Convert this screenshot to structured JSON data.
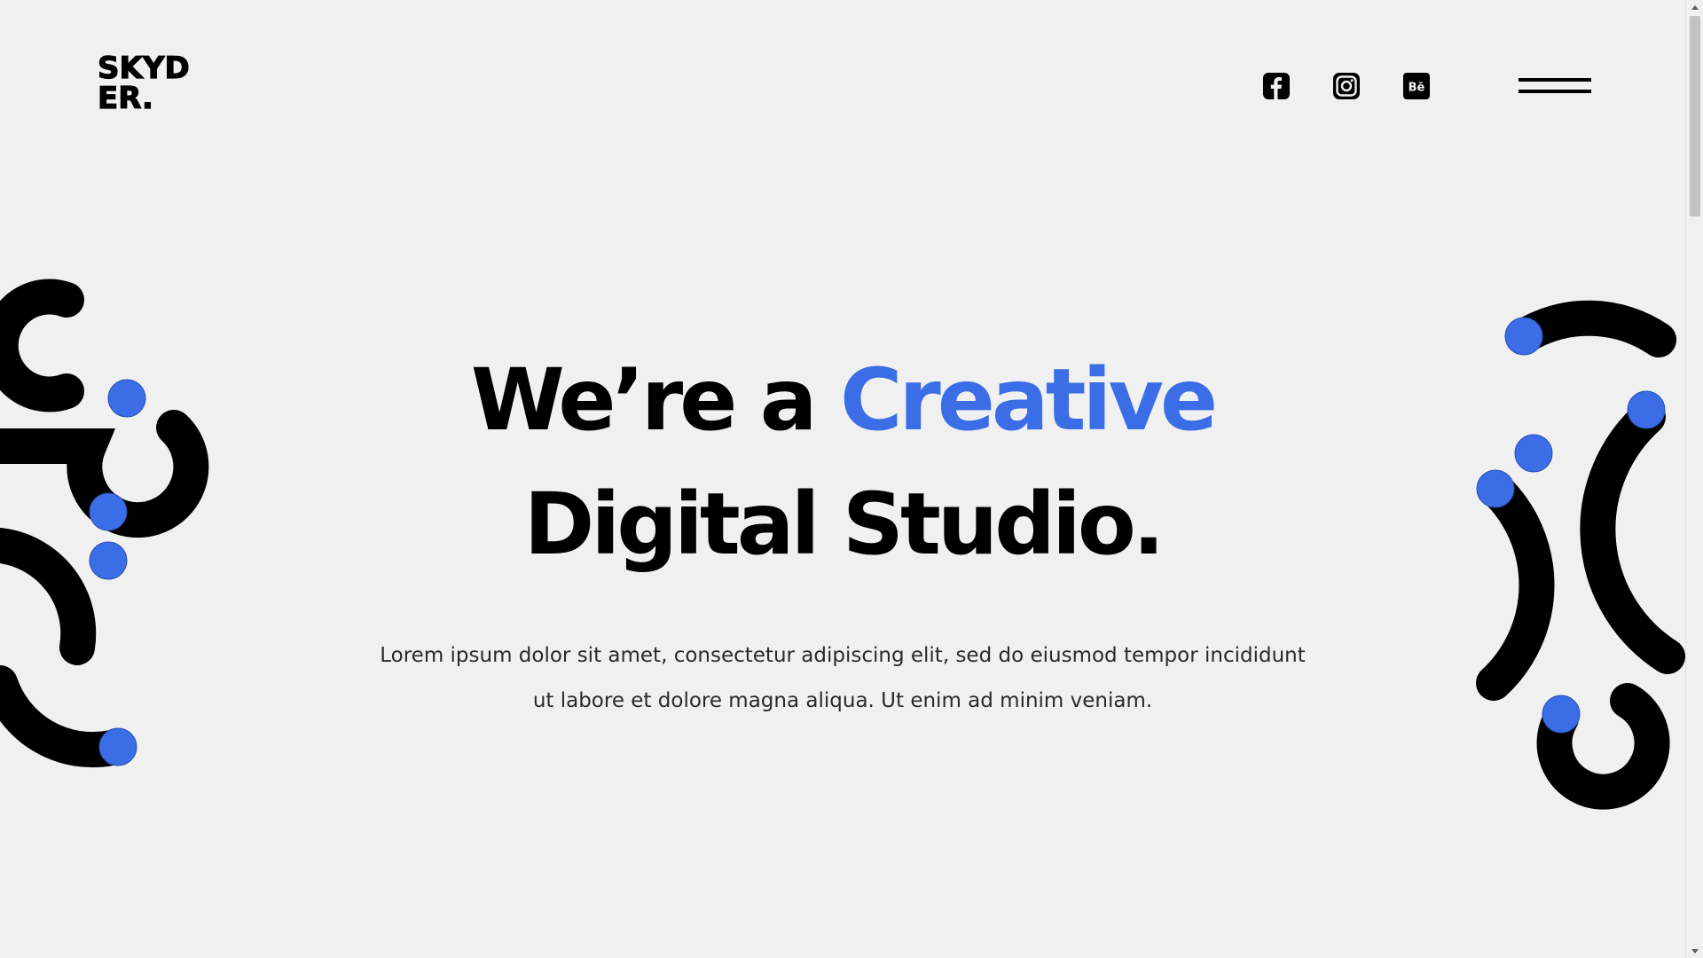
{
  "brand": {
    "logo_line1": "SKYD",
    "logo_line2": "ER."
  },
  "header": {
    "social": [
      {
        "name": "facebook-icon",
        "label": "Facebook"
      },
      {
        "name": "instagram-icon",
        "label": "Instagram"
      },
      {
        "name": "behance-icon",
        "label": "Bē"
      }
    ]
  },
  "hero": {
    "title_part1": "We’re a ",
    "title_accent": "Creative",
    "title_line2": "Digital Studio.",
    "description": "Lorem ipsum dolor sit amet, consectetur adipiscing elit, sed do eiusmod tempor incididunt ut labore et dolore magna aliqua. Ut enim ad minim veniam."
  },
  "colors": {
    "accent": "#3a6de6",
    "background": "#f0f0f0",
    "text": "#000000"
  }
}
